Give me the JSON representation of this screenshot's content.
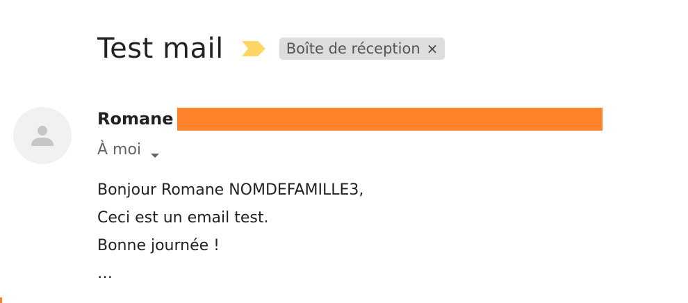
{
  "subject": "Test mail",
  "label": {
    "text": "Boîte de réception",
    "remove_glyph": "×"
  },
  "sender": {
    "name": "Romane"
  },
  "recipient": {
    "text": "À moi"
  },
  "body_lines": [
    "Bonjour Romane NOMDEFAMILLE3,",
    "Ceci est un email test.",
    "Bonne journée !",
    "…"
  ],
  "icons": {
    "importance": "importance-marker-icon",
    "avatar": "person-icon",
    "recipient_details": "caret-down-icon"
  },
  "colors": {
    "importance_marker": "#fdd663",
    "redaction": "#ff8129",
    "chip_background": "#dddddd"
  }
}
